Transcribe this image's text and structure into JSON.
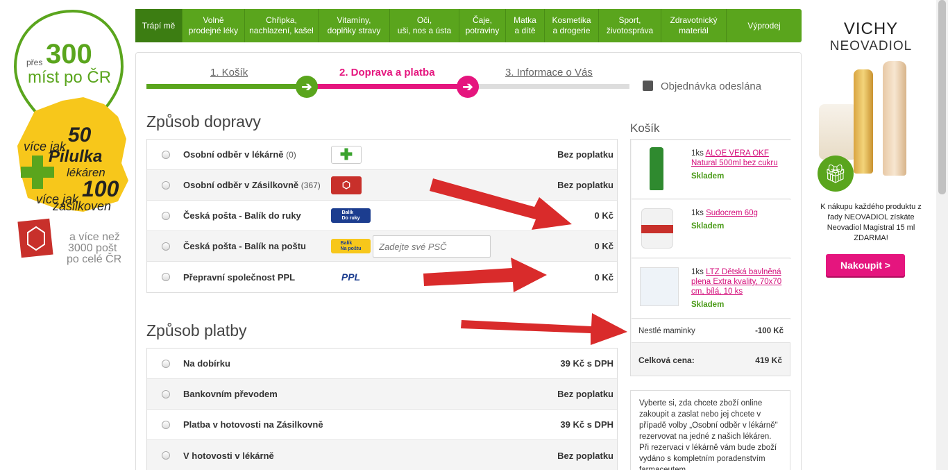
{
  "left_banner": {
    "pres": "přes",
    "n300": "300",
    "mist": "míst po ČR",
    "vice_jak1": "více jak",
    "n50": "50",
    "pilulka": "Pilulka",
    "lekaren": "lékáren",
    "vice_jak2": "více jak",
    "n100": "100",
    "zasilkoven": "zásilkoven",
    "a_vice": "a více než",
    "posts": "3000 pošt",
    "po_cr": "po celé ČR"
  },
  "nav": [
    {
      "label": "Trápí mě"
    },
    {
      "label": "Volně\nprodejné léky"
    },
    {
      "label": "Chřipka,\nnachlazení, kašel"
    },
    {
      "label": "Vitamíny,\ndoplňky stravy"
    },
    {
      "label": "Oči,\nuši, nos a ústa"
    },
    {
      "label": "Čaje,\npotraviny"
    },
    {
      "label": "Matka\na dítě"
    },
    {
      "label": "Kosmetika\na drogerie"
    },
    {
      "label": "Sport,\nživotospráva"
    },
    {
      "label": "Zdravotnický\nmateriál"
    },
    {
      "label": "Výprodej"
    }
  ],
  "steps": {
    "s1": "1. Košík",
    "s2": "2. Doprava a platba",
    "s3": "3. Informace o Vás",
    "s4": "Objednávka odeslána"
  },
  "shipping": {
    "title": "Způsob dopravy",
    "options": [
      {
        "name": "Osobní odběr v lékárně",
        "count": "(0)",
        "price": "Bez poplatku"
      },
      {
        "name": "Osobní odběr v Zásilkovně",
        "count": "(367)",
        "price": "Bez poplatku"
      },
      {
        "name": "Česká pošta - Balík do ruky",
        "count": "",
        "price": "0 Kč",
        "logo": "Balík\nDo ruky"
      },
      {
        "name": "Česká pošta - Balík na poštu",
        "count": "",
        "price": "0 Kč",
        "logo": "Balík\nNa poštu"
      },
      {
        "name": "Přepravní společnost PPL",
        "count": "",
        "price": "0 Kč",
        "logo": "PPL"
      }
    ],
    "psc_placeholder": "Zadejte své PSČ"
  },
  "payment": {
    "title": "Způsob platby",
    "options": [
      {
        "name": "Na dobírku",
        "price": "39 Kč s DPH"
      },
      {
        "name": "Bankovním převodem",
        "price": "Bez poplatku"
      },
      {
        "name": "Platba v hotovosti na Zásilkovně",
        "price": "39 Kč s DPH"
      },
      {
        "name": "V hotovosti v lékárně",
        "price": "Bez poplatku"
      }
    ]
  },
  "cart": {
    "title": "Košík",
    "items": [
      {
        "qty": "1ks",
        "name": "ALOE VERA OKF Natural 500ml bez cukru",
        "stock": "Skladem"
      },
      {
        "qty": "1ks",
        "name": "Sudocrem 60g",
        "stock": "Skladem"
      },
      {
        "qty": "1ks",
        "name": "LTZ Dětská bavlněná plena Extra kvality, 70x70 cm, bílá, 10 ks",
        "stock": "Skladem"
      }
    ],
    "discount_label": "Nestlé maminky",
    "discount_value": "-100 Kč",
    "total_label": "Celková cena:",
    "total_value": "419 Kč"
  },
  "info_text": "Vyberte si, zda chcete zboží online zakoupit a zaslat nebo jej chcete v případě volby „Osobní odběr v lékárně\" rezervovat na jedné z našich lékáren. Při rezervaci v lékárně vám bude zboží vydáno s kompletním poradenstvím farmaceutem.",
  "right_ad": {
    "brand": "VICHY",
    "product": "NEOVADIOL",
    "text": "K nákupu každého produktu z řady NEOVADIOL získáte Neovadiol Magistral 15 ml ZDARMA!",
    "button": "Nakoupit >"
  },
  "colors": {
    "green": "#5aa51d",
    "pink": "#e5157e",
    "arrow": "#d92b2b"
  }
}
